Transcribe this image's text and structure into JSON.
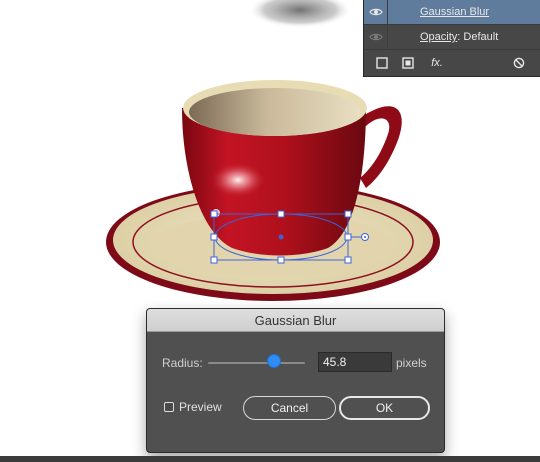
{
  "appearance_panel": {
    "effect_label": "Gaussian Blur",
    "opacity_label": "Opacity",
    "opacity_value": ": Default",
    "fx_label": "fx.",
    "icons": [
      "visibility-eye-icon",
      "visibility-eye-icon",
      "add-stroke-icon",
      "add-fill-icon",
      "add-effect-icon",
      "clear-appearance-icon"
    ]
  },
  "dialog": {
    "title": "Gaussian Blur",
    "radius_label": "Radius:",
    "radius_value": "45.8",
    "radius_unit": "pixels",
    "slider_fraction": 0.68,
    "preview_label": "Preview",
    "preview_checked": false,
    "cancel_label": "Cancel",
    "ok_label": "OK"
  },
  "colors": {
    "cup_red": "#b3101c",
    "saucer_cream": "#e8dcb5",
    "selection_blue": "#3d63d6",
    "panel_bg": "#474747",
    "panel_selected": "#5f7c9c",
    "dialog_bg": "#505050",
    "slider_accent": "#2f8cf2"
  }
}
